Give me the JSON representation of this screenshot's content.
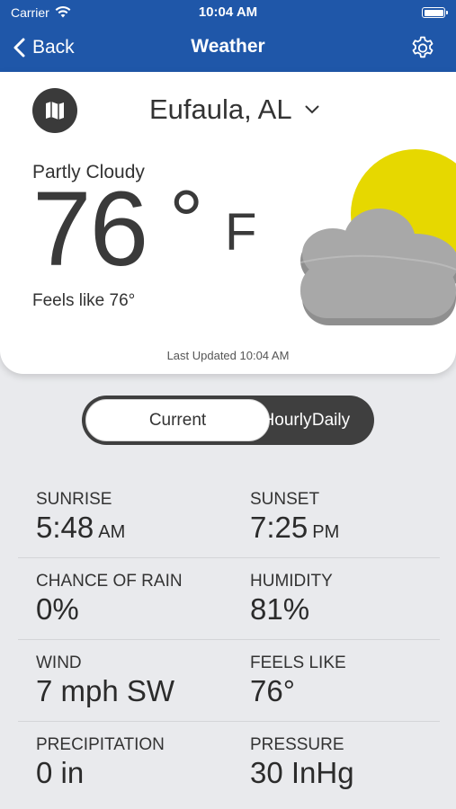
{
  "status_bar": {
    "carrier": "Carrier",
    "time": "10:04 AM"
  },
  "nav": {
    "back_label": "Back",
    "title": "Weather"
  },
  "card": {
    "location": "Eufaula, AL",
    "condition": "Partly Cloudy",
    "temperature": "76",
    "degree": "°",
    "unit": "F",
    "feels_like": "Feels like 76°",
    "last_updated": "Last Updated 10:04 AM"
  },
  "tabs": [
    {
      "label": "Current",
      "selected": true
    },
    {
      "label": "Hourly",
      "selected": false
    },
    {
      "label": "Daily",
      "selected": false
    }
  ],
  "details": {
    "sunrise": {
      "label": "SUNRISE",
      "value": "5:48",
      "unit": "AM"
    },
    "sunset": {
      "label": "SUNSET",
      "value": "7:25",
      "unit": "PM"
    },
    "chance_of_rain": {
      "label": "CHANCE OF RAIN",
      "value": "0%"
    },
    "humidity": {
      "label": "HUMIDITY",
      "value": "81%"
    },
    "wind": {
      "label": "WIND",
      "value": "7 mph SW"
    },
    "feels_like": {
      "label": "FEELS LIKE",
      "value": "76°"
    },
    "precipitation": {
      "label": "PRECIPITATION",
      "value": "0 in"
    },
    "pressure": {
      "label": "PRESSURE",
      "value": "30 InHg"
    }
  },
  "colors": {
    "header": "#1f57a9",
    "sun": "#e6d800",
    "cloud": "#a5a5a5",
    "segmented_bg": "#3f3f3f",
    "page_bg": "#e9eaed"
  },
  "icons": {
    "wifi": "wifi-icon",
    "battery": "battery-icon",
    "back": "chevron-left-icon",
    "settings": "gear-icon",
    "map": "map-icon",
    "dropdown": "chevron-down-icon",
    "weather": "partly-cloudy-icon"
  }
}
